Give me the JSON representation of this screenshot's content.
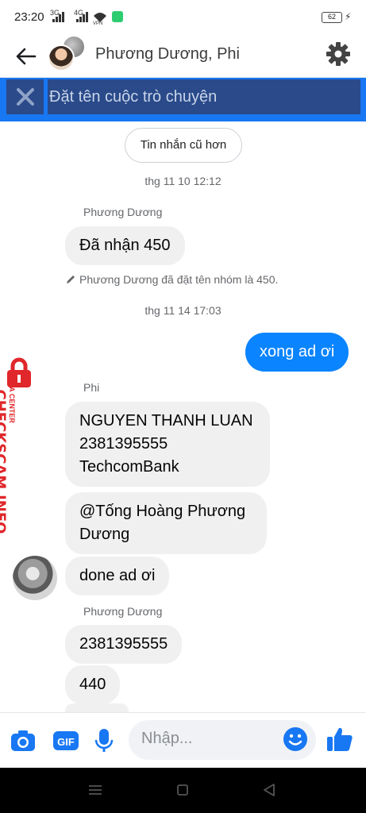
{
  "status_bar": {
    "time": "23:20",
    "signal1_label": "3G",
    "signal2_label": "4G",
    "vpn_label": "VPN",
    "battery": "62"
  },
  "header": {
    "title": "Phương Dương, Phi"
  },
  "rename": {
    "placeholder": "Đặt tên cuộc trò chuyện"
  },
  "chat": {
    "older_button": "Tin nhắn cũ hơn",
    "timestamp1": "thg 11 10 12:12",
    "sender1": "Phương Dương",
    "msg1": "Đã nhận 450",
    "system_msg": "Phương Dương đã đặt tên nhóm là 450.",
    "timestamp2": "thg 11 14 17:03",
    "out_msg": "xong ad ơi",
    "sender2": "Phi",
    "msg2_line1": "NGUYEN THANH LUAN",
    "msg2_line2": "2381395555",
    "msg2_line3": "TechcomBank",
    "msg3_line1": "@Tống Hoàng Phương",
    "msg3_line2": "Dương",
    "msg4": "done ad ơi",
    "sender3": "Phương Dương",
    "msg5": "2381395555",
    "msg6": "440"
  },
  "watermark": {
    "brand": "CHECKSCAM.INFO",
    "sub": "DATA CENTER"
  },
  "composer": {
    "placeholder": "Nhập..."
  },
  "colors": {
    "accent": "#1877f2",
    "bubble_out": "#0a84ff",
    "bubble_in": "#f0f0f0",
    "watermark": "#e0272b"
  }
}
